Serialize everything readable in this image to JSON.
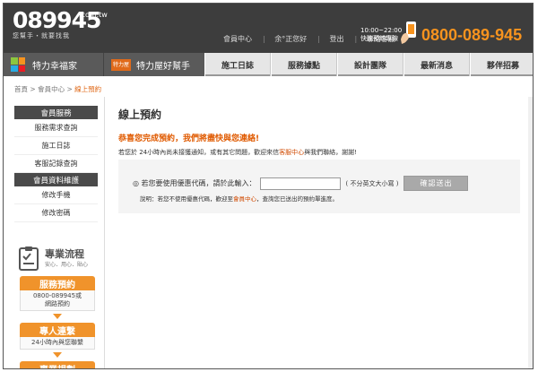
{
  "header": {
    "logo_text": "089945",
    "logo_tld": ".com.tw",
    "slogan": "您幫手・就要找我",
    "links": [
      "會員中心",
      "余°正您好",
      "登出",
      "聯絡客服"
    ],
    "hours_line1": "10:00~22:00",
    "hours_line2": "快速預約專線",
    "phone": "0800-089-945"
  },
  "nav": {
    "brand1": "特力幸福家",
    "brand2_tag": "特力屋",
    "brand2": "特力屋好幫手",
    "items": [
      "施工日誌",
      "服務據點",
      "設計團隊",
      "最新消息",
      "夥伴招募"
    ]
  },
  "breadcrumb": {
    "home": "首頁",
    "sep": ">",
    "member": "會員中心",
    "current": "線上預約"
  },
  "sidebar": {
    "section1": "會員服務",
    "items1": [
      "服務需求查詢",
      "施工日誌",
      "客服記錄查詢"
    ],
    "section2": "會員資料維護",
    "items2": [
      "修改手機",
      "修改密碼"
    ]
  },
  "promo": {
    "title": "專業流程",
    "subtitle": "安心．用心．貼心",
    "step1_title": "服務預約",
    "step1_line1": "0800-089945或",
    "step1_line2": "網路預約",
    "step2_title": "專人連繫",
    "step2_line1": "24小時內與您聯繫",
    "step3_title": "專業規劃"
  },
  "main": {
    "title": "線上預約",
    "congrats": "恭喜您完成預約，我們將盡快與您連絡!",
    "notice_pre": "若您於 24小時內尚未接獲通知，或有其它問題，歡迎來信",
    "notice_link": "客服中心",
    "notice_post": "與我們聯絡，謝謝!",
    "form_label": "◎ 若您要使用優惠代碼，請於此輸入：",
    "input_value": "",
    "input_hint": "( 不分英文大小寫 )",
    "submit_label": "確認送出",
    "explain_pre": "說明：若您不使用優惠代碼，歡迎至",
    "explain_link": "會員中心",
    "explain_post": "，查詢您已送出的預約單進度。"
  }
}
